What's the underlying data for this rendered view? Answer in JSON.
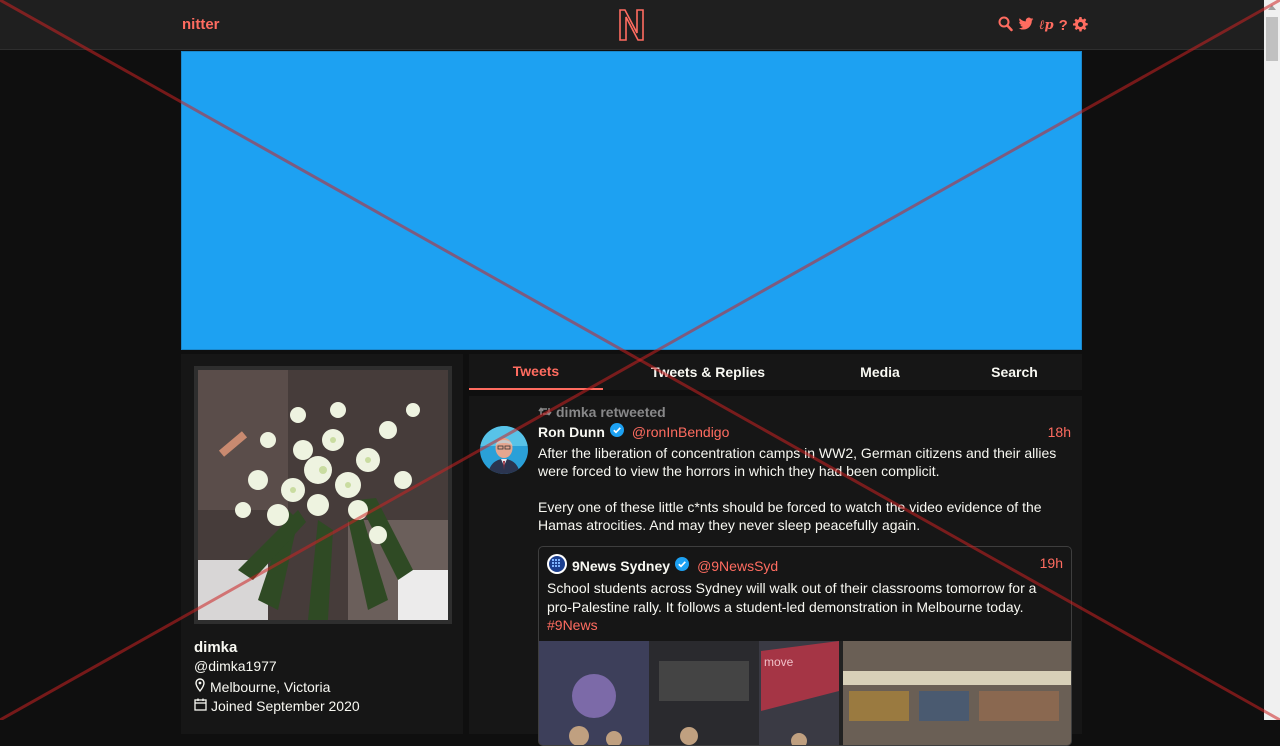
{
  "navbar": {
    "brand": "nitter",
    "logo_letter": "N"
  },
  "profile": {
    "name": "dimka",
    "handle": "@dimka1977",
    "location": "Melbourne, Victoria",
    "joined": "Joined September 2020"
  },
  "tabs": [
    {
      "label": "Tweets",
      "active": true
    },
    {
      "label": "Tweets & Replies",
      "active": false
    },
    {
      "label": "Media",
      "active": false
    },
    {
      "label": "Search",
      "active": false
    }
  ],
  "tweet": {
    "retweet_label": "dimka retweeted",
    "author_name": "Ron Dunn",
    "author_handle": "@ronInBendigo",
    "date": "18h",
    "paragraph1": "After the liberation of concentration camps in WW2, German citizens and their allies were forced to view the horrors in which they had been complicit.",
    "paragraph2": "Every one of these little c*nts should be forced to watch the video evidence of the Hamas atrocities. And may they never sleep peacefully again.",
    "quote": {
      "author_name": "9News Sydney",
      "author_handle": "@9NewsSyd",
      "date": "19h",
      "text": "School students across Sydney will walk out of their classrooms tomorrow for a pro-Palestine rally. It follows a student-led demonstration in Melbourne today.",
      "hashtag": "#9News",
      "media_text": "move"
    }
  },
  "colors": {
    "accent": "#ff6c60",
    "banner": "#1da1f2",
    "background": "#0f0f0f",
    "panel": "#161616",
    "navbar": "#1f1f1f",
    "verified": "#1da1f2"
  }
}
